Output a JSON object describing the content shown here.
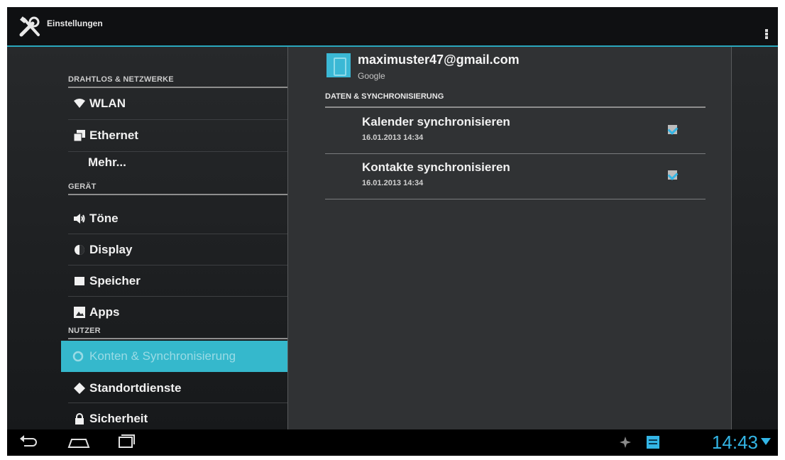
{
  "app": {
    "title": "Einstellungen",
    "icon": "tools-icon"
  },
  "colors": {
    "accent": "#33b5e5",
    "active_item_bg": "#35b8cc",
    "background": "#1e2022"
  },
  "sidebar": {
    "sections": [
      {
        "header": "DRAHTLOS & NETZWERKE"
      },
      {
        "header": "GERÄT"
      },
      {
        "header": "NUTZER"
      }
    ],
    "items": [
      {
        "label": "WLAN",
        "icon": "wifi-icon"
      },
      {
        "label": "Ethernet",
        "icon": "ethernet-icon"
      },
      {
        "label": "Mehr..."
      },
      {
        "label": "Töne",
        "icon": "sound-icon"
      },
      {
        "label": "Display",
        "icon": "display-icon"
      },
      {
        "label": "Speicher",
        "icon": "storage-icon"
      },
      {
        "label": "Apps",
        "icon": "apps-icon"
      },
      {
        "label": "Konten & Synchronisierung",
        "icon": "sync-icon",
        "active": true
      },
      {
        "label": "Standortdienste",
        "icon": "location-icon"
      },
      {
        "label": "Sicherheit",
        "icon": "lock-icon"
      }
    ]
  },
  "detail": {
    "account": {
      "email": "maximuster47@gmail.com",
      "provider": "Google"
    },
    "section_header": "DATEN & SYNCHRONISIERUNG",
    "sync_items": [
      {
        "title": "Kalender synchronisieren",
        "date": "16.01.2013 14:34",
        "checked": true
      },
      {
        "title": "Kontakte synchronisieren",
        "date": "16.01.2013 14:34",
        "checked": true
      }
    ]
  },
  "system_bar": {
    "time": "14:43"
  }
}
